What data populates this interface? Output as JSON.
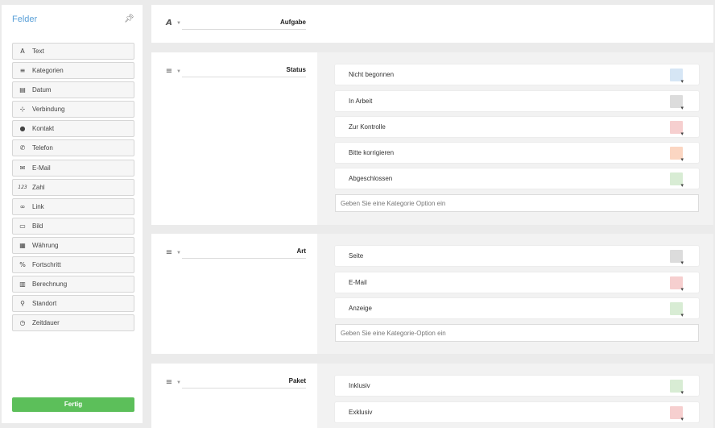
{
  "sidebar": {
    "title": "Felder",
    "items": [
      {
        "label": "Text",
        "icon": "A"
      },
      {
        "label": "Kategorien",
        "icon": "≡"
      },
      {
        "label": "Datum",
        "icon": "▤"
      },
      {
        "label": "Verbindung",
        "icon": "⊹"
      },
      {
        "label": "Kontakt",
        "icon": "●"
      },
      {
        "label": "Telefon",
        "icon": "✆"
      },
      {
        "label": "E-Mail",
        "icon": "✉"
      },
      {
        "label": "Zahl",
        "icon": "123"
      },
      {
        "label": "Link",
        "icon": "∞"
      },
      {
        "label": "Bild",
        "icon": "▭"
      },
      {
        "label": "Währung",
        "icon": "▦"
      },
      {
        "label": "Fortschritt",
        "icon": "%"
      },
      {
        "label": "Berechnung",
        "icon": "▥"
      },
      {
        "label": "Standort",
        "icon": "⚲"
      },
      {
        "label": "Zeitdauer",
        "icon": "◷"
      }
    ],
    "done_label": "Fertig"
  },
  "sections": {
    "aufgabe": {
      "icon": "A",
      "name": "Aufgabe"
    },
    "status": {
      "icon": "≡",
      "name": "Status",
      "options": [
        {
          "label": "Nicht begonnen",
          "color": "#d6e6f5"
        },
        {
          "label": "In Arbeit",
          "color": "#dcdcdc"
        },
        {
          "label": "Zur Kontrolle",
          "color": "#f6cfcf"
        },
        {
          "label": "Bitte korrigieren",
          "color": "#fbd6c2"
        },
        {
          "label": "Abgeschlossen",
          "color": "#d8ecd4"
        }
      ],
      "placeholder": "Geben Sie eine Kategorie Option ein"
    },
    "art": {
      "icon": "≡",
      "name": "Art",
      "options": [
        {
          "label": "Seite",
          "color": "#dcdcdc"
        },
        {
          "label": "E-Mail",
          "color": "#f6cfcf"
        },
        {
          "label": "Anzeige",
          "color": "#d8ecd4"
        }
      ],
      "placeholder": "Geben Sie eine Kategorie-Option ein"
    },
    "paket": {
      "icon": "≡",
      "name": "Paket",
      "options": [
        {
          "label": "Inklusiv",
          "color": "#d8ecd4"
        },
        {
          "label": "Exklusiv",
          "color": "#f6cfcf"
        }
      ]
    }
  }
}
